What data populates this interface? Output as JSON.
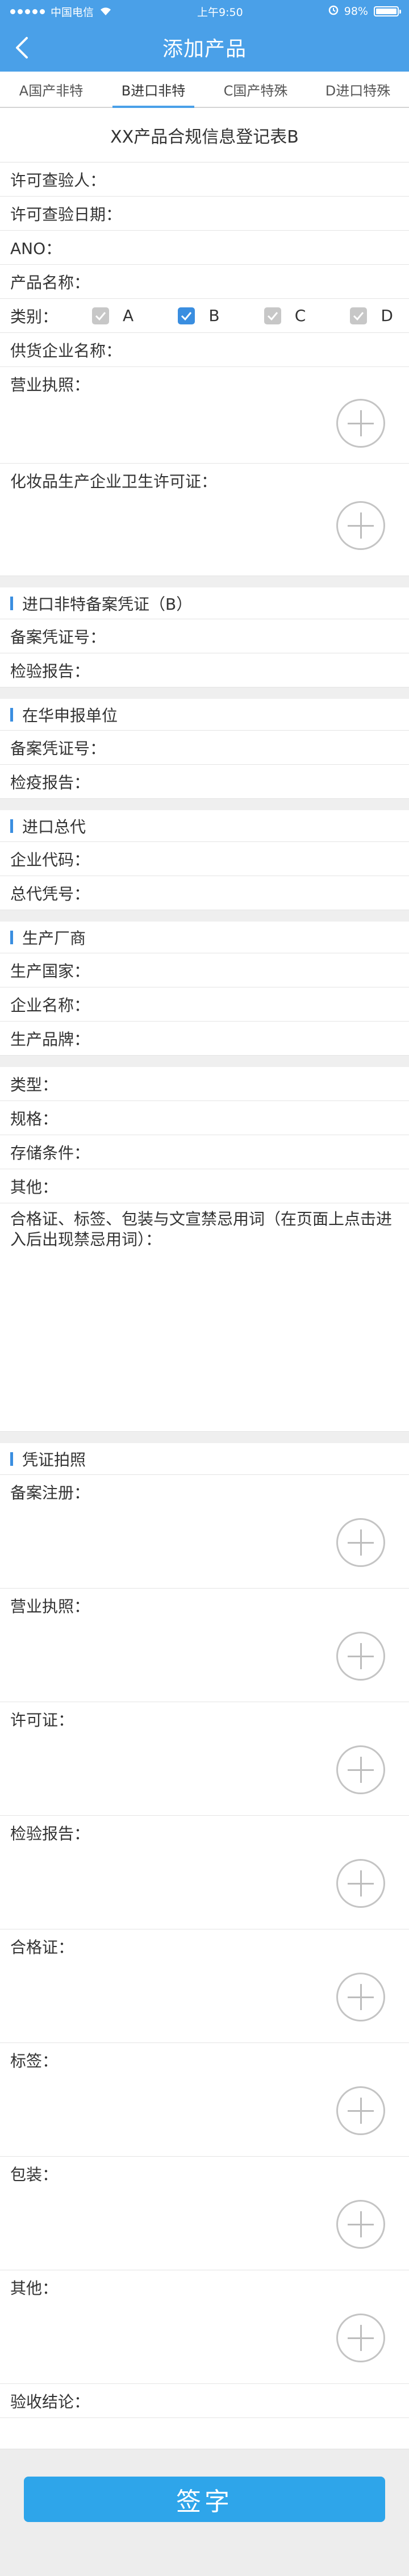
{
  "status_bar": {
    "carrier": "中国电信",
    "time": "上午9:50",
    "battery": "98%"
  },
  "nav": {
    "title": "添加产品"
  },
  "tabs": [
    {
      "label": "A国产非特"
    },
    {
      "label": "B进口非特"
    },
    {
      "label": "C国产特殊"
    },
    {
      "label": "D进口特殊"
    }
  ],
  "active_tab": "B进口非特",
  "form_title": "XX产品合规信息登记表B",
  "basic": {
    "inspector": "许可查验人：",
    "inspect_date": "许可查验日期：",
    "ano": "ANO：",
    "product_name": "产品名称：",
    "category": "类别：",
    "supplier": "供货企业名称：",
    "business_license": "营业执照：",
    "hygiene_license": "化妆品生产企业卫生许可证："
  },
  "categories": [
    {
      "label": "A",
      "checked": false
    },
    {
      "label": "B",
      "checked": true
    },
    {
      "label": "C",
      "checked": false
    },
    {
      "label": "D",
      "checked": false
    }
  ],
  "sec_import": {
    "title": "进口非特备案凭证（B）",
    "cert_no": "备案凭证号：",
    "report": "检验报告："
  },
  "sec_china": {
    "title": "在华申报单位",
    "cert_no": "备案凭证号：",
    "report": "检疫报告："
  },
  "sec_agent": {
    "title": "进口总代",
    "code": "企业代码：",
    "cert": "总代凭号："
  },
  "sec_maker": {
    "title": "生产厂商",
    "country": "生产国家：",
    "company": "企业名称：",
    "brand": "生产品牌："
  },
  "specs": {
    "type": "类型：",
    "spec": "规格：",
    "storage": "存储条件：",
    "other": "其他：",
    "warning": "合格证、标签、包装与文宣禁忌用词（在页面上点击进入后出现禁忌用词）："
  },
  "sec_photos": {
    "title": "凭证拍照",
    "items": [
      "备案注册：",
      "营业执照：",
      "许可证：",
      "检验报告：",
      "合格证：",
      "标签：",
      "包装：",
      "其他："
    ]
  },
  "conclusion": "验收结论：",
  "sign_button": "签字",
  "colors": {
    "primary": "#4aa0e8",
    "button": "#2ea5ea",
    "checkbox_on": "#3a8ee0"
  }
}
